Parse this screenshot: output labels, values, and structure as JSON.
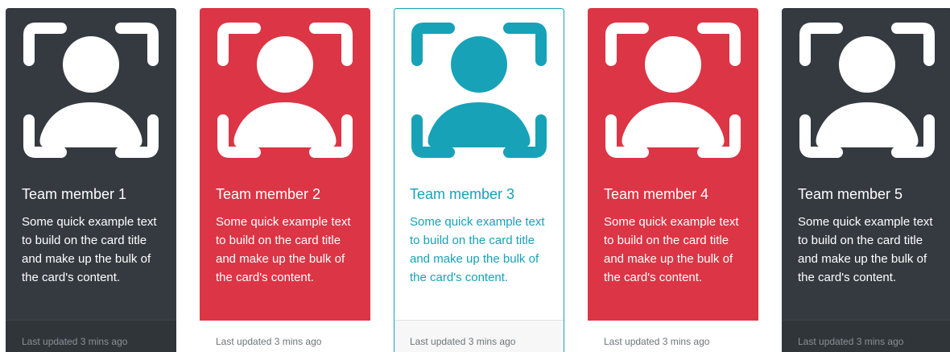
{
  "colors": {
    "dark": "#343a40",
    "danger": "#dc3545",
    "info": "#17a2b8",
    "white": "#ffffff",
    "muted": "#6c757d"
  },
  "icon": "user-focus-icon",
  "cards": [
    {
      "title": "Team member 1",
      "text": "Some quick example text to build on the card title and make up the bulk of the card's content.",
      "footer": "Last updated 3 mins ago",
      "variant": "dark"
    },
    {
      "title": "Team member 2",
      "text": "Some quick example text to build on the card title and make up the bulk of the card's content.",
      "footer": "Last updated 3 mins ago",
      "variant": "danger"
    },
    {
      "title": "Team member 3",
      "text": "Some quick example text to build on the card title and make up the bulk of the card's content.",
      "footer": "Last updated 3 mins ago",
      "variant": "info-outline"
    },
    {
      "title": "Team member 4",
      "text": "Some quick example text to build on the card title and make up the bulk of the card's content.",
      "footer": "Last updated 3 mins ago",
      "variant": "danger"
    },
    {
      "title": "Team member 5",
      "text": "Some quick example text to build on the card title and make up the bulk of the card's content.",
      "footer": "Last updated 3 mins ago",
      "variant": "dark"
    }
  ]
}
